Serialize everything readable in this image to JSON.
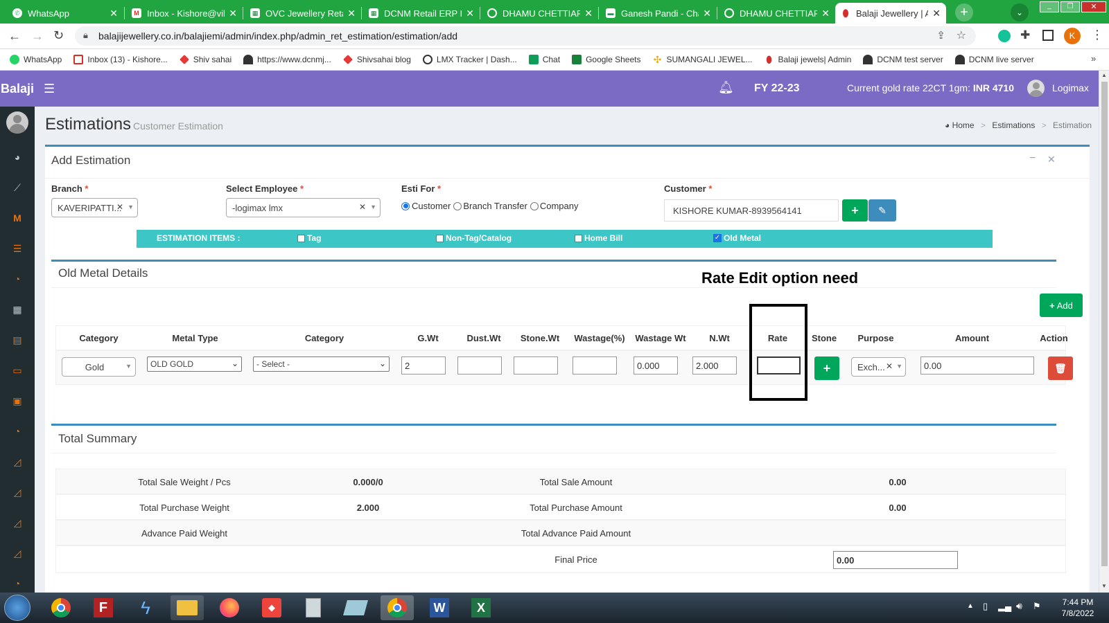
{
  "browser": {
    "tabs": [
      {
        "label": "WhatsApp",
        "icon": "whatsapp-icon"
      },
      {
        "label": "Inbox - Kishore@vik",
        "icon": "gmail-icon"
      },
      {
        "label": "OVC Jewellery Retai",
        "icon": "sheets-icon"
      },
      {
        "label": "DCNM Retail ERP In",
        "icon": "sheets-icon"
      },
      {
        "label": "DHAMU CHETTIAR",
        "icon": "globe-icon"
      },
      {
        "label": "Ganesh Pandi - Cha",
        "icon": "chat-icon"
      },
      {
        "label": "DHAMU CHETTIAR",
        "icon": "globe-icon"
      },
      {
        "label": "Balaji Jewellery | Ad",
        "icon": "balaji-icon"
      }
    ],
    "url": "balajijewellery.co.in/balajiemi/admin/index.php/admin_ret_estimation/estimation/add",
    "profile_initial": "K",
    "bookmarks": [
      {
        "label": "WhatsApp",
        "icon": "whatsapp-icon"
      },
      {
        "label": "Inbox (13) - Kishore...",
        "icon": "gmail-icon"
      },
      {
        "label": "Shiv sahai",
        "icon": "diamond-icon"
      },
      {
        "label": "https://www.dcnmj...",
        "icon": "logimax-icon"
      },
      {
        "label": "Shivsahai blog",
        "icon": "diamond-icon"
      },
      {
        "label": "LMX Tracker | Dash...",
        "icon": "globe-icon"
      },
      {
        "label": "Chat",
        "icon": "chat-icon"
      },
      {
        "label": "Google Sheets",
        "icon": "sheets-icon"
      },
      {
        "label": "SUMANGALI JEWEL...",
        "icon": "sun-icon"
      },
      {
        "label": "Balaji jewels| Admin",
        "icon": "balaji-icon"
      },
      {
        "label": "DCNM test server",
        "icon": "logimax-icon"
      },
      {
        "label": "DCNM live server",
        "icon": "logimax-icon"
      }
    ]
  },
  "header": {
    "brand": "Balaji",
    "fy": "FY 22-23",
    "gold_rate_label": "Current gold rate 22CT 1gm:",
    "gold_rate_value": "INR 4710",
    "user": "Logimax"
  },
  "page": {
    "title": "Estimations",
    "subtitle": "Customer Estimation",
    "breadcrumb": [
      "Home",
      "Estimations",
      "Estimation"
    ]
  },
  "form": {
    "box_title": "Add Estimation",
    "branch_label": "Branch",
    "branch_value": "KAVERIPATTI...",
    "employee_label": "Select Employee",
    "employee_value": "-logimax lmx",
    "esti_for_label": "Esti For",
    "esti_for_options": [
      "Customer",
      "Branch Transfer",
      "Company"
    ],
    "esti_for_selected": "Customer",
    "customer_label": "Customer",
    "customer_value": "KISHORE KUMAR-8939564141",
    "items_label": "ESTIMATION ITEMS :",
    "items": [
      {
        "label": "Tag",
        "checked": false
      },
      {
        "label": "Non-Tag/Catalog",
        "checked": false
      },
      {
        "label": "Home Bill",
        "checked": false
      },
      {
        "label": "Old Metal",
        "checked": true
      }
    ]
  },
  "old_metal": {
    "title": "Old Metal Details",
    "annotation": "Rate Edit option need",
    "add_label": "Add",
    "columns": [
      "Category",
      "Metal Type",
      "Category",
      "G.Wt",
      "Dust.Wt",
      "Stone.Wt",
      "Wastage(%)",
      "Wastage Wt",
      "N.Wt",
      "Rate",
      "Stone",
      "Purpose",
      "Amount",
      "Action"
    ],
    "row": {
      "category": "Gold",
      "metal_type": "OLD GOLD",
      "category2": "- Select -",
      "gwt": "2",
      "dustwt": "",
      "stonewt": "",
      "wastage_pct": "",
      "wastage_wt": "0.000",
      "nwt": "2.000",
      "rate": "",
      "purpose": "Exch...",
      "amount": "0.00"
    }
  },
  "summary": {
    "title": "Total Summary",
    "rows": [
      {
        "l1": "Total Sale Weight / Pcs",
        "v1": "0.000/0",
        "l2": "Total Sale Amount",
        "v2": "0.00"
      },
      {
        "l1": "Total Purchase Weight",
        "v1": "2.000",
        "l2": "Total Purchase Amount",
        "v2": "0.00"
      },
      {
        "l1": "Advance Paid Weight",
        "v1": "",
        "l2": "Total Advance Paid Amount",
        "v2": ""
      },
      {
        "l1": "",
        "v1": "",
        "l2": "Final Price",
        "v2": "0.00"
      }
    ]
  },
  "taskbar": {
    "time": "7:44 PM",
    "date": "7/8/2022"
  },
  "colors": {
    "tabstrip": "#20a540",
    "header": "#7c6bc4",
    "sidebar": "#222d32",
    "items_bar": "#3dc6c6",
    "success": "#00a65a",
    "primary": "#3c8dbc",
    "danger": "#dd4b39"
  }
}
